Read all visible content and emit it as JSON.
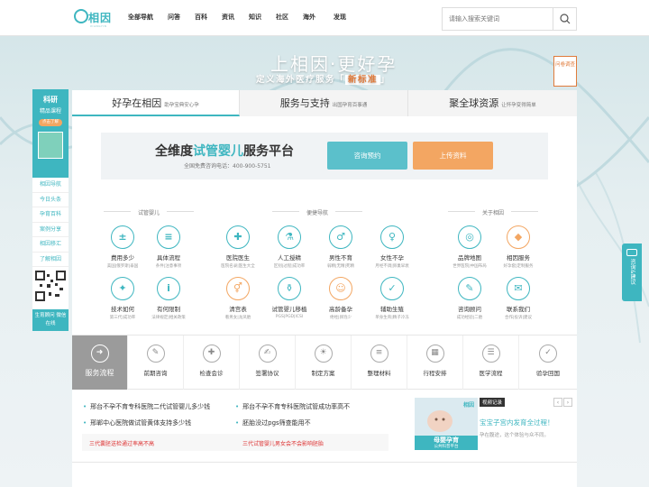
{
  "header": {
    "logo_text": "相因",
    "logo_sub": "XIANGYIN",
    "nav": [
      "全部导航",
      "问答",
      "百科",
      "资讯",
      "知识",
      "社区",
      "海外",
      "发现"
    ],
    "search_placeholder": "请输入搜索关键词"
  },
  "banner": {
    "slogan": "上相因·更好孕",
    "subslogan_prefix": "定义海外医疗服务「",
    "subslogan_highlight": "新标准",
    "subslogan_suffix": "」",
    "badge": "问卷调查"
  },
  "tabs": [
    {
      "title": "好孕在相因",
      "sub": "助孕宝典安心孕"
    },
    {
      "title": "服务与支持",
      "sub": "出国孕育百事通"
    },
    {
      "title": "聚全球资源",
      "sub": "让怀孕变得简单"
    }
  ],
  "promo": {
    "title_pre": "全维度",
    "title_highlight": "试管婴儿",
    "title_post": "服务平台",
    "phone": "全国免费咨询电话：400-900-5751",
    "btn_consult": "咨询预约",
    "btn_upload": "上传资料"
  },
  "groups": [
    "试管婴儿",
    "便捷导航",
    "关于相因"
  ],
  "items": [
    {
      "name": "费用多少",
      "sub": "美国|俄罗斯|泰国"
    },
    {
      "name": "具体流程",
      "sub": "条件|注意事项"
    },
    {
      "name": "医院医生",
      "sub": "医院名录|医生大全"
    },
    {
      "name": "人工授精",
      "sub": "区别|过程|成功率"
    },
    {
      "name": "男性不育",
      "sub": "弱精|无精|死精"
    },
    {
      "name": "女性不孕",
      "sub": "月经不调|卵巢早衰"
    },
    {
      "name": "品牌地图",
      "sub": "世界医院|中国布局"
    },
    {
      "name": "相因服务",
      "sub": "好孕套|定制服务"
    },
    {
      "name": "技术如何",
      "sub": "第三代|成功率"
    },
    {
      "name": "有何限制",
      "sub": "法律规定|相关政策"
    },
    {
      "name": "清宫表",
      "sub": "看男女|龙凤胎"
    },
    {
      "name": "试管婴儿移植",
      "sub": "PGS|PGD|ICSI"
    },
    {
      "name": "高龄备孕",
      "sub": "绝经|卵泡少"
    },
    {
      "name": "辅助生殖",
      "sub": "单身生育|精子冷冻"
    },
    {
      "name": "咨询顾问",
      "sub": "成功经验|二胎"
    },
    {
      "name": "联系我们",
      "sub": "合作|投诉|建议"
    }
  ],
  "flow": [
    "服务流程",
    "前期咨询",
    "检查会诊",
    "签署协议",
    "制定方案",
    "整理材料",
    "行程安排",
    "医学流程",
    "验孕回国"
  ],
  "news": [
    "邢台不孕不育专科医院二代试管婴儿多少钱",
    "邢台不孕不育专科医院试管成功率高不",
    "邢郸中心医院做试管黄体支持多少钱",
    "胚胎没过pgs筛查能用不"
  ],
  "red_links": [
    "三代囊胚送检通过率高不高",
    "三代试管婴儿男女会不会影响胚胎"
  ],
  "sidebar": {
    "top_title": "科研",
    "top_sub": "精品课程",
    "top_btn": "点击了解",
    "links": [
      "相因导航",
      "今日头条",
      "孕育百科",
      "案例分享",
      "相因移汇",
      "了解相因"
    ],
    "bottom": "生育顾问 微信在线"
  },
  "right_tab": "咨询&建议",
  "ad": {
    "brand": "相因",
    "caption": "母婴孕育",
    "caption_sub": "公共科普平台",
    "tag": "视频记录",
    "title": "宝宝子宫内发育全过程！",
    "desc": "孕在腹途，这个体验与众不同。"
  },
  "colors": {
    "accent": "#3eb6c0",
    "orange": "#f3a662",
    "teal_btn": "#5bc0cb",
    "red": "#dd3333"
  }
}
